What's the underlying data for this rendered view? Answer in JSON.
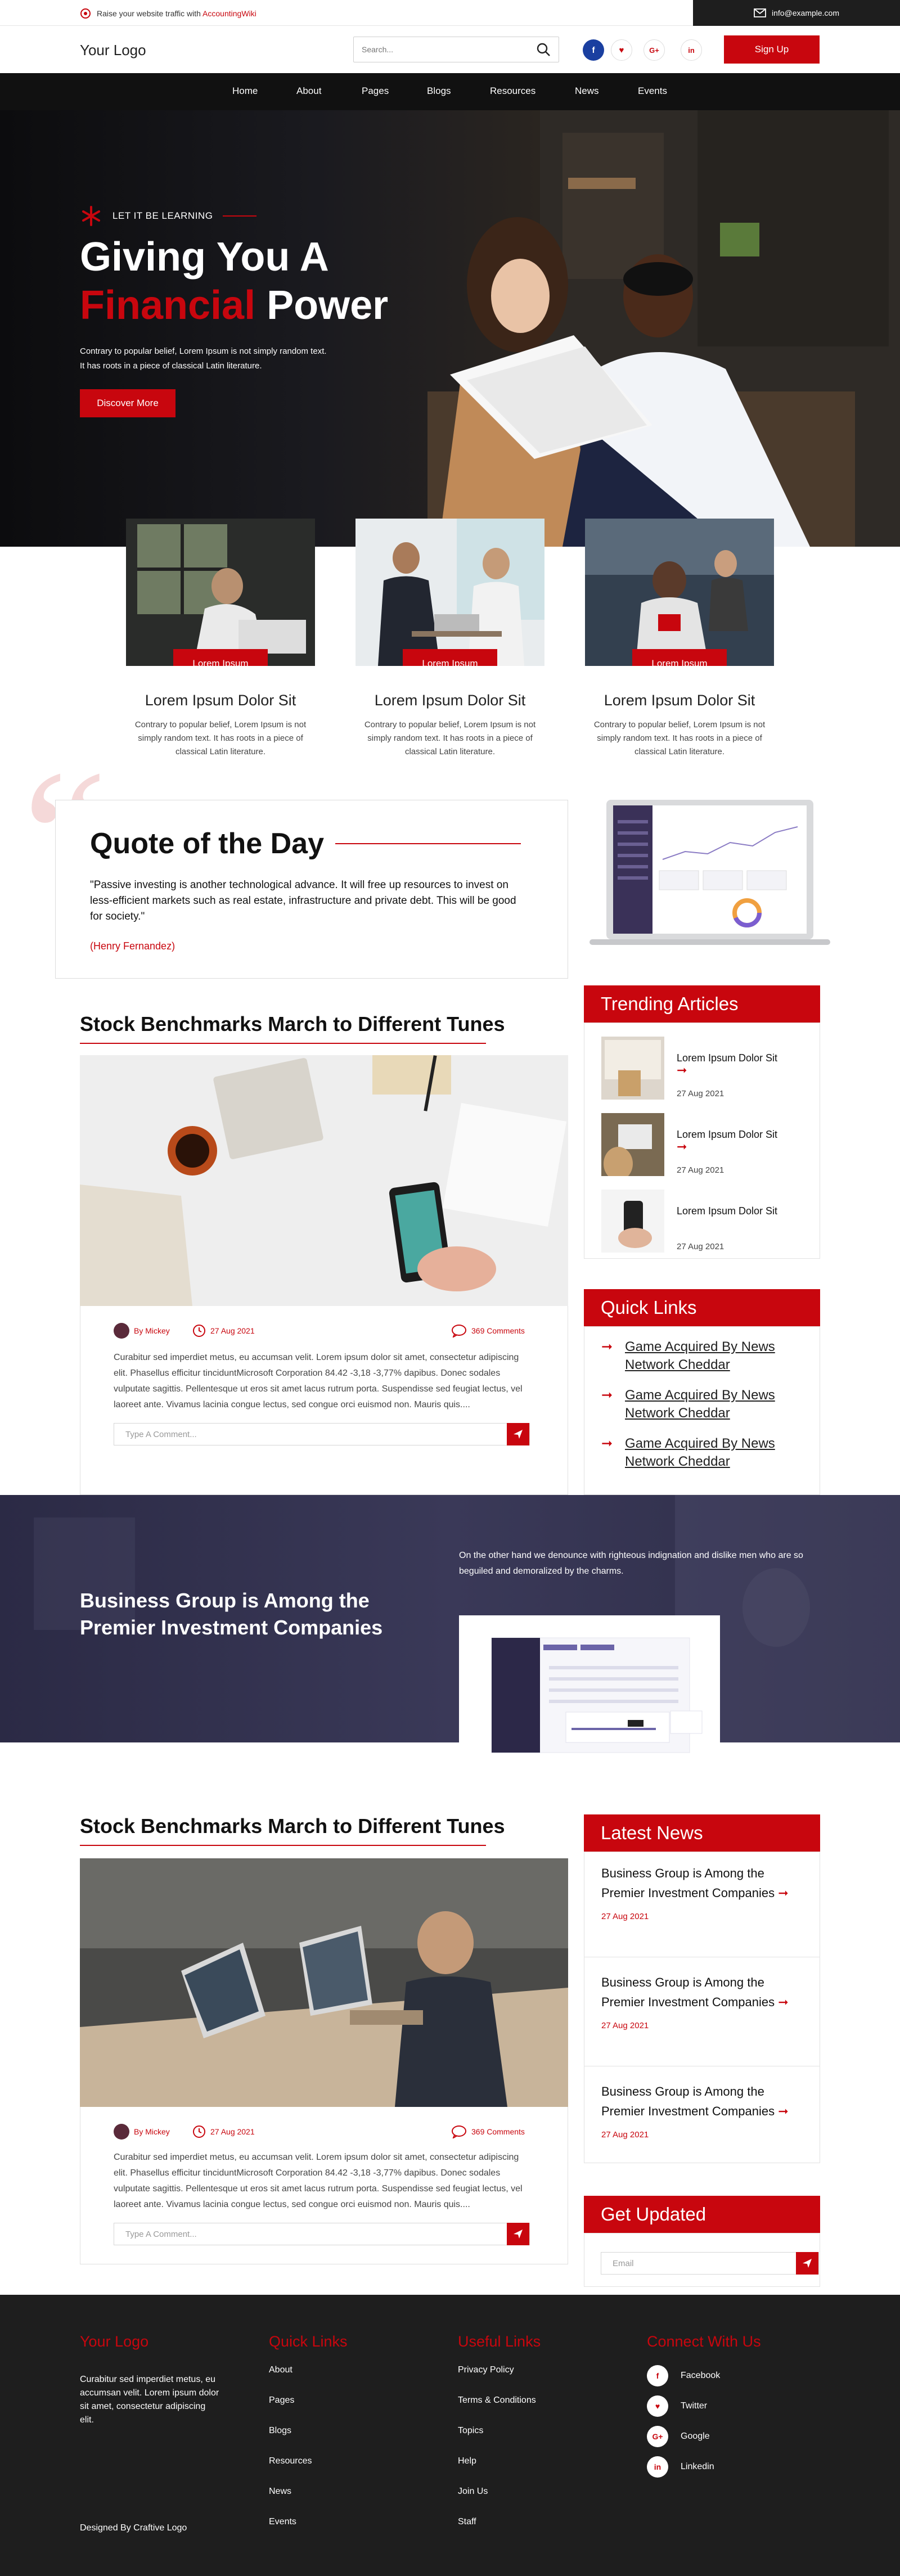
{
  "topbar": {
    "promo_text": "Raise your website traffic with ",
    "promo_brand": "AccountingWiki",
    "email": "info@example.com"
  },
  "header": {
    "logo": "Your Logo",
    "search_placeholder": "Search...",
    "signup": "Sign Up",
    "social": [
      "f",
      "♥",
      "G+",
      "in"
    ]
  },
  "nav": [
    "Home",
    "About",
    "Pages",
    "Blogs",
    "Resources",
    "News",
    "Events"
  ],
  "hero": {
    "eyebrow": "LET IT BE LEARNING",
    "title_line1": "Giving You A",
    "title_accent": "Financial",
    "title_rest": " Power",
    "text_line1": "Contrary to popular belief, Lorem Ipsum is not simply random text.",
    "text_line2": "It has roots in a piece of classical Latin literature.",
    "cta": "Discover More"
  },
  "cards": [
    {
      "label": "Lorem Ipsum",
      "title": "Lorem Ipsum Dolor Sit",
      "text": "Contrary to popular belief, Lorem Ipsum is not simply random text. It has roots in a piece of classical Latin literature."
    },
    {
      "label": "Lorem Ipsum",
      "title": "Lorem Ipsum Dolor Sit",
      "text": "Contrary to popular belief, Lorem Ipsum is not simply random text. It has roots in a piece of classical Latin literature."
    },
    {
      "label": "Lorem Ipsum",
      "title": "Lorem Ipsum Dolor Sit",
      "text": "Contrary to popular belief, Lorem Ipsum is not simply random text. It has roots in a piece of classical Latin literature."
    }
  ],
  "quote": {
    "title": "Quote of the Day",
    "text": "\"Passive investing is another technological advance. It will free up resources to invest on less-efficient markets such as real estate, infrastructure and private debt. This will be good for society.\"",
    "author": "(Henry Fernandez)"
  },
  "articles": [
    {
      "title": "Stock Benchmarks March to Different Tunes",
      "author": "By Mickey",
      "date": "27 Aug 2021",
      "comments": "369 Comments",
      "text": "Curabitur sed imperdiet metus, eu accumsan velit. Lorem ipsum dolor sit amet, consectetur adipiscing elit. Phasellus efficitur tinciduntMicrosoft Corporation 84.42 -3,18 -3,77% dapibus. Donec sodales vulputate sagittis. Pellentesque ut eros sit amet lacus rutrum porta. Suspendisse sed feugiat lectus, vel laoreet ante. Vivamus lacinia congue lectus, sed congue orci euismod non. Mauris quis....",
      "comment_placeholder": "Type A Comment..."
    },
    {
      "title": "Stock Benchmarks March to Different Tunes",
      "author": "By Mickey",
      "date": "27 Aug 2021",
      "comments": "369 Comments",
      "text": "Curabitur sed imperdiet metus, eu accumsan velit. Lorem ipsum dolor sit amet, consectetur adipiscing elit. Phasellus efficitur tinciduntMicrosoft Corporation 84.42 -3,18 -3,77% dapibus. Donec sodales vulputate sagittis. Pellentesque ut eros sit amet lacus rutrum porta. Suspendisse sed feugiat lectus, vel laoreet ante. Vivamus lacinia congue lectus, sed congue orci euismod non. Mauris quis....",
      "comment_placeholder": "Type A Comment..."
    }
  ],
  "trending": {
    "title": "Trending Articles",
    "items": [
      {
        "title": "Lorem Ipsum Dolor Sit",
        "date": "27 Aug 2021"
      },
      {
        "title": "Lorem Ipsum Dolor Sit",
        "date": "27 Aug 2021"
      },
      {
        "title": "Lorem Ipsum Dolor Sit",
        "date": "27 Aug 2021"
      }
    ]
  },
  "quicklinks": {
    "title": "Quick Links",
    "items": [
      "Game Acquired By News Network Cheddar",
      "Game Acquired By News Network Cheddar",
      "Game Acquired By News Network Cheddar"
    ]
  },
  "band": {
    "title_line1": "Business Group is Among the",
    "title_line2": "Premier Investment Companies",
    "text": "On the other hand we denounce with righteous indignation and dislike men who are so beguiled and demoralized by the charms."
  },
  "latest": {
    "title": "Latest News",
    "items": [
      {
        "title": "Business Group is Among the Premier Investment Companies",
        "date": "27 Aug 2021"
      },
      {
        "title": "Business Group is Among the Premier Investment Companies",
        "date": "27 Aug 2021"
      },
      {
        "title": "Business Group is Among the Premier Investment Companies",
        "date": "27 Aug 2021"
      }
    ]
  },
  "updated": {
    "title": "Get Updated",
    "placeholder": "Email"
  },
  "footer": {
    "logo": "Your Logo",
    "about": "Curabitur sed imperdiet metus, eu accumsan velit. Lorem ipsum dolor sit amet, consectetur adipiscing elit.",
    "designed": "Designed By Craftive Logo",
    "quick_title": "Quick Links",
    "quick": [
      "About",
      "Pages",
      "Blogs",
      "Resources",
      "News",
      "Events"
    ],
    "useful_title": "Useful Links",
    "useful": [
      "Privacy Policy",
      "Terms & Conditions",
      "Topics",
      "Help",
      "Join Us",
      "Staff"
    ],
    "connect_title": "Connect With Us",
    "connect": [
      {
        "icon": "f",
        "label": "Facebook"
      },
      {
        "icon": "♥",
        "label": "Twitter"
      },
      {
        "icon": "G+",
        "label": "Google"
      },
      {
        "icon": "in",
        "label": "Linkedin"
      }
    ]
  },
  "colors": {
    "accent": "#c8060e",
    "dark": "#1e1e1e",
    "band": "#34334f"
  }
}
